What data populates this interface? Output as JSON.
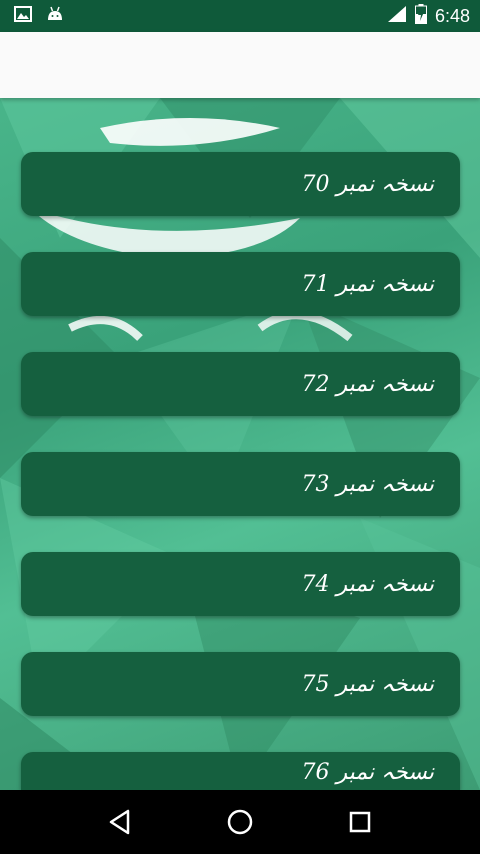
{
  "status_bar": {
    "time": "6:48",
    "icons": [
      "image-icon",
      "android-icon",
      "signal-icon",
      "battery-charging-icon"
    ]
  },
  "list": {
    "items": [
      {
        "label": "نسخہ نمبر 70"
      },
      {
        "label": "نسخہ نمبر 71"
      },
      {
        "label": "نسخہ نمبر 72"
      },
      {
        "label": "نسخہ نمبر 73"
      },
      {
        "label": "نسخہ نمبر 74"
      },
      {
        "label": "نسخہ نمبر 75"
      },
      {
        "label": "نسخہ نمبر 76"
      }
    ]
  },
  "nav_bar": {
    "buttons": [
      "back-icon",
      "home-icon",
      "recents-icon"
    ]
  },
  "colors": {
    "status_bar": "#0f5a3a",
    "item_bg": "#15603f",
    "background": "#3aa27a",
    "app_bar": "#fafafa"
  }
}
